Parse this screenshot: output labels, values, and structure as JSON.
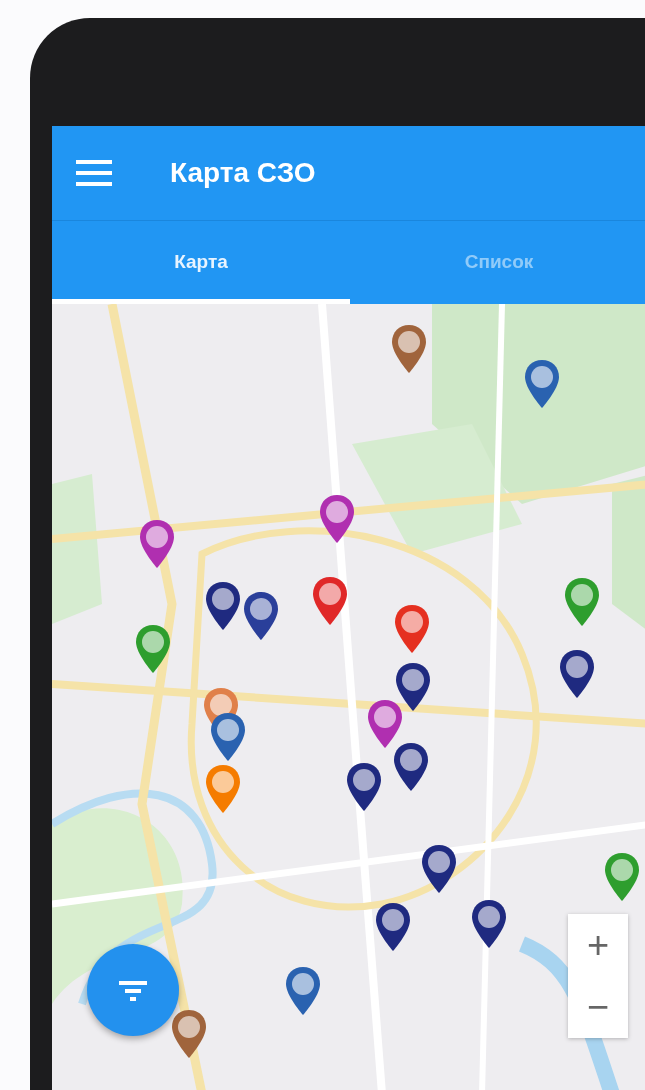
{
  "app_bar": {
    "title": "Карта СЗО"
  },
  "tabs": [
    {
      "label": "Карта",
      "selected": true
    },
    {
      "label": "Список",
      "selected": false
    }
  ],
  "map": {
    "pins": [
      {
        "color": "#a0643c"
      },
      {
        "color": "#2a62b0"
      },
      {
        "color": "#b02fb0"
      },
      {
        "color": "#b02fb0"
      },
      {
        "color": "#1f2a80"
      },
      {
        "color": "#2a3f9a"
      },
      {
        "color": "#e02828"
      },
      {
        "color": "#2e9e2e"
      },
      {
        "color": "#2e9e2e"
      },
      {
        "color": "#e53020"
      },
      {
        "color": "#1f2a80"
      },
      {
        "color": "#1f2a80"
      },
      {
        "color": "#e0804a"
      },
      {
        "color": "#2a62b0"
      },
      {
        "color": "#b02fb0"
      },
      {
        "color": "#1f2a80"
      },
      {
        "color": "#1f2a80"
      },
      {
        "color": "#f57c00"
      },
      {
        "color": "#1f2a80"
      },
      {
        "color": "#2e9e2e"
      },
      {
        "color": "#1f2a80"
      },
      {
        "color": "#1f2a80"
      },
      {
        "color": "#2a62b0"
      },
      {
        "color": "#a0643c"
      }
    ],
    "zoom_controls": [
      "+",
      "−"
    ]
  }
}
